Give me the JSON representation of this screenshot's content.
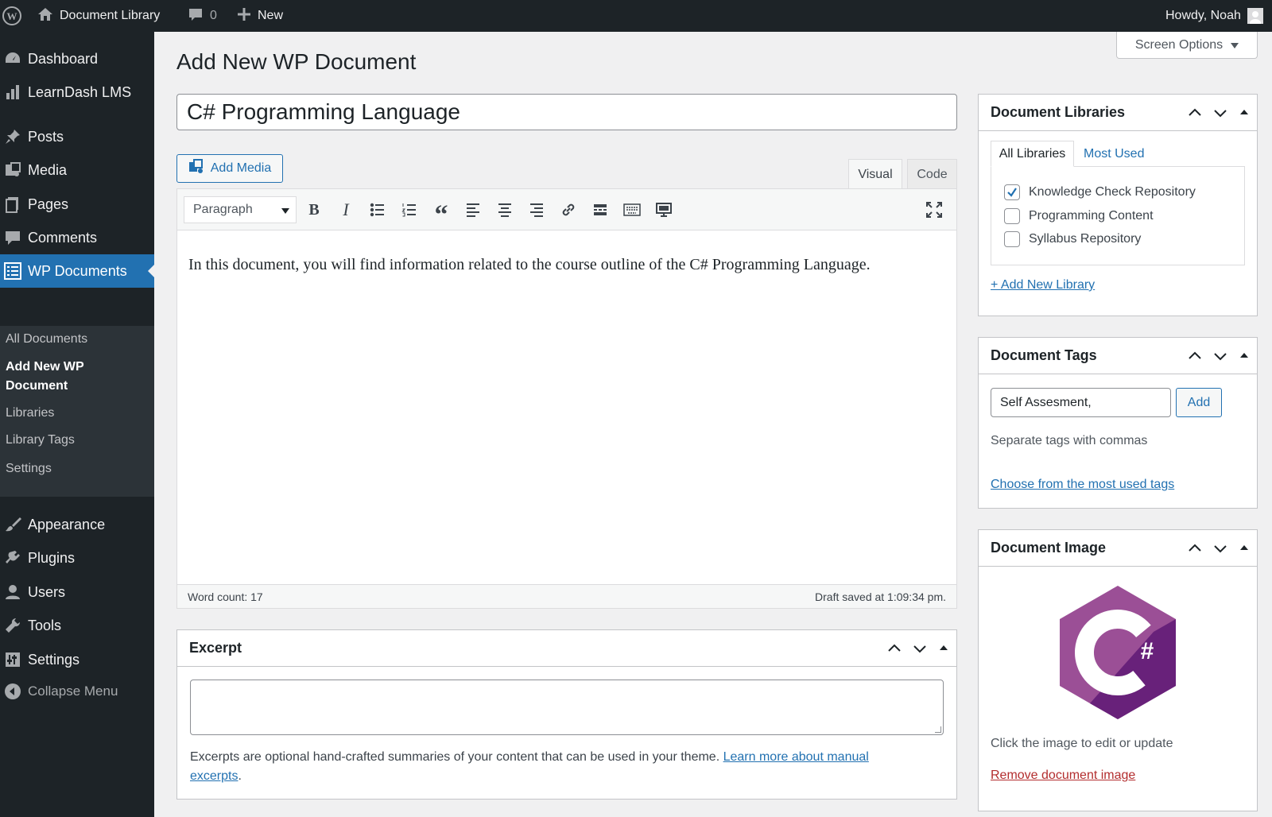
{
  "admin_bar": {
    "site_name": "Document Library",
    "comments_count": "0",
    "new_label": "New",
    "howdy": "Howdy, Noah"
  },
  "sidebar": {
    "items": [
      {
        "label": "Dashboard",
        "icon": "dashboard-icon"
      },
      {
        "label": "LearnDash LMS",
        "icon": "bar-chart-icon"
      },
      {
        "label": "Posts",
        "icon": "pin-icon"
      },
      {
        "label": "Media",
        "icon": "media-icon"
      },
      {
        "label": "Pages",
        "icon": "pages-icon"
      },
      {
        "label": "Comments",
        "icon": "comment-icon"
      },
      {
        "label": "WP Documents",
        "icon": "list-icon"
      },
      {
        "label": "Appearance",
        "icon": "brush-icon"
      },
      {
        "label": "Plugins",
        "icon": "plug-icon"
      },
      {
        "label": "Users",
        "icon": "user-icon"
      },
      {
        "label": "Tools",
        "icon": "wrench-icon"
      },
      {
        "label": "Settings",
        "icon": "settings-icon"
      },
      {
        "label": "Collapse Menu",
        "icon": "collapse-icon"
      }
    ],
    "submenu": [
      "All Documents",
      "Add New WP Document",
      "Libraries",
      "Library Tags",
      "Settings"
    ]
  },
  "page": {
    "title": "Add New WP Document",
    "screen_options": "Screen Options",
    "post_title": "C# Programming Language"
  },
  "editor": {
    "add_media": "Add Media",
    "tab_visual": "Visual",
    "tab_code": "Code",
    "format": "Paragraph",
    "content": "In this document, you will find information related to the course outline of the C# Programming Language.",
    "word_count": "Word count: 17",
    "draft_saved": "Draft saved at 1:09:34 pm."
  },
  "excerpt": {
    "title": "Excerpt",
    "value": "",
    "help": "Excerpts are optional hand-crafted summaries of your content that can be used in your theme.",
    "help_link_1": "Learn more about manual",
    "help_link_2": "excerpts",
    "period": "."
  },
  "libraries": {
    "title": "Document Libraries",
    "tab_all": "All Libraries",
    "tab_most_used": "Most Used",
    "items": [
      {
        "label": "Knowledge Check Repository",
        "checked": true
      },
      {
        "label": "Programming Content",
        "checked": false
      },
      {
        "label": "Syllabus Repository",
        "checked": false
      }
    ],
    "add_new": "+ Add New Library"
  },
  "tags": {
    "title": "Document Tags",
    "input_value": "Self Assesment,",
    "add_button": "Add",
    "help": "Separate tags with commas",
    "choose_link": "Choose from the most used tags"
  },
  "image": {
    "title": "Document Image",
    "logo_text": "C#",
    "help": "Click the image to edit or update",
    "remove_link": "Remove document image"
  },
  "colors": {
    "admin_bar": "#1d2327",
    "accent": "#2271b1",
    "danger": "#b32d2e",
    "csharp_light": "#9b4f96",
    "csharp_dark": "#68217a"
  }
}
